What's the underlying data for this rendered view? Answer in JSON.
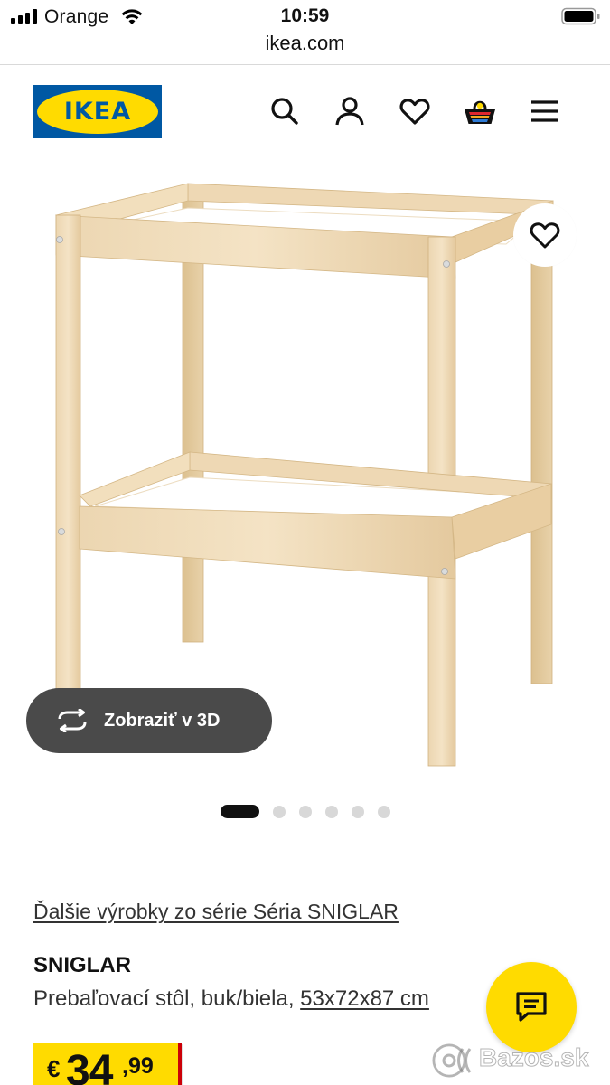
{
  "status_bar": {
    "carrier": "Orange",
    "time": "10:59"
  },
  "browser": {
    "url": "ikea.com"
  },
  "header": {
    "logo_text": "IKEA",
    "brand_colors": {
      "blue": "#0058a3",
      "yellow": "#ffdb00"
    },
    "icons": [
      "search-icon",
      "account-icon",
      "favorites-icon",
      "cart-icon",
      "menu-icon"
    ]
  },
  "gallery": {
    "view_3d_label": "Zobraziť v 3D",
    "image_count": 6,
    "active_image": 1
  },
  "product": {
    "series_link": "Ďalšie výrobky zo série Séria SNIGLAR",
    "name": "SNIGLAR",
    "description": "Prebaľovací stôl, buk/biela,",
    "size": "53x72x87 cm",
    "price": {
      "currency": "€",
      "integer": "34",
      "decimal": ",99"
    }
  },
  "watermark": {
    "text": "Bazos.sk"
  }
}
